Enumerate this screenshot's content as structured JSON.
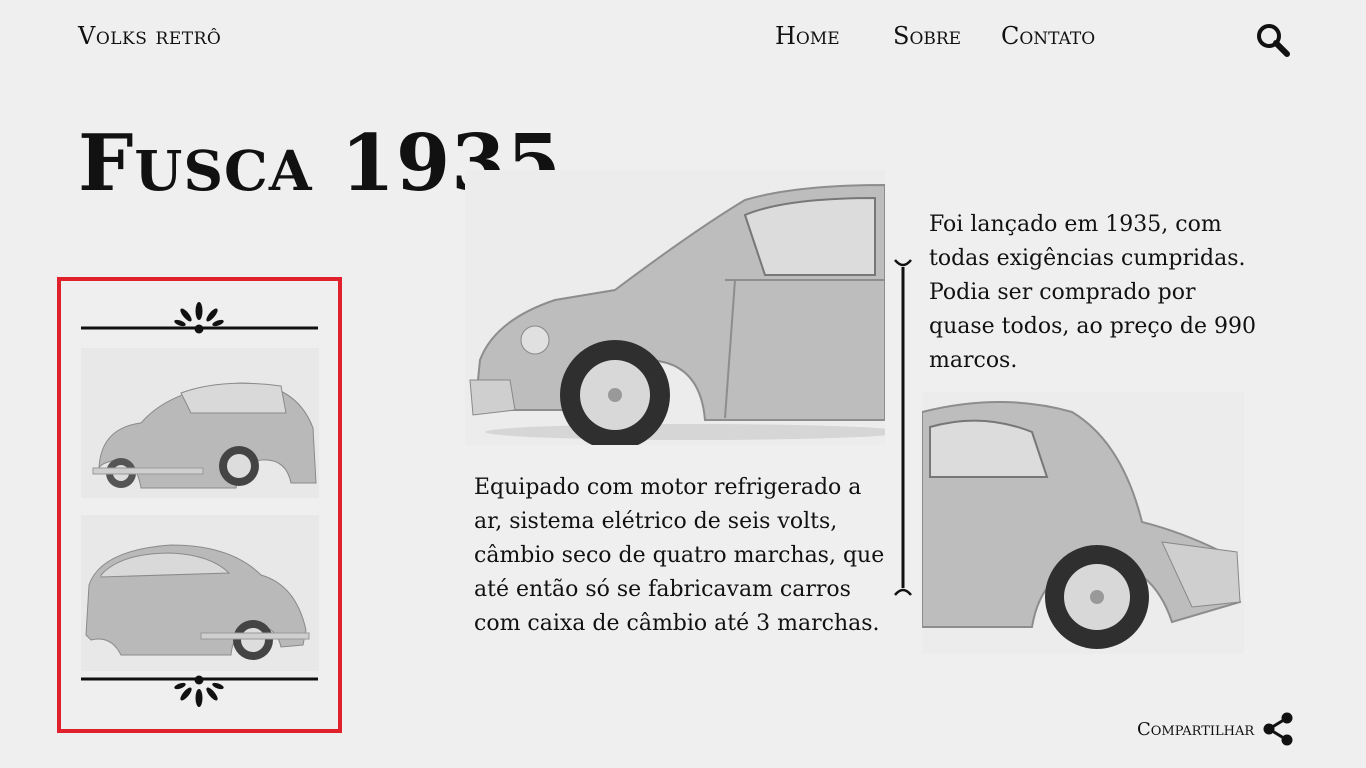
{
  "header": {
    "brand": "Volks retrô",
    "nav": [
      "Home",
      "Sobre",
      "Contato"
    ],
    "search_icon": "search-icon"
  },
  "main": {
    "title": "Fusca 1935",
    "paragraph_top": "Foi lançado em 1935, com todas exigências cumpridas. Podia ser comprado por quase todos, ao preço de 990 marcos.",
    "paragraph_bottom": "Equipado com motor refrigerado a ar, sistema elétrico de seis volts, câmbio seco de quatro marchas, que até então só se fabricavam carros com caixa de câmbio até 3 marchas."
  },
  "gallery": {
    "highlight_color": "#e0212b",
    "thumbnails": [
      "beetle-front-three-quarter",
      "beetle-side-front-three-quarter"
    ]
  },
  "footer": {
    "share_label": "Compartilhar",
    "share_icon": "share-icon"
  }
}
